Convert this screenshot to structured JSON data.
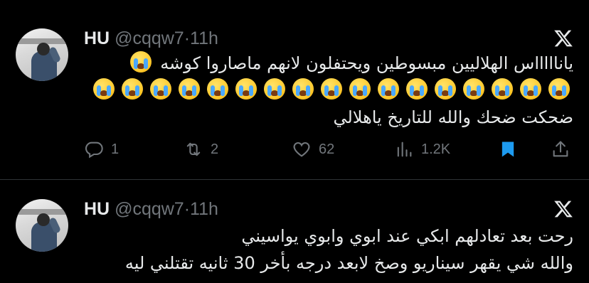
{
  "tweets": [
    {
      "name": "HU",
      "handle": "@cqqw7",
      "separator": "·",
      "time": "11h",
      "lines": [
        "ياناااااس الهلاليين مبسوطين ويحتفلون لانهم ماصاروا كوشه",
        "",
        "ضحكت ضحك والله للتاريخ ياهلالي"
      ],
      "emoji_count_line1": 1,
      "emoji_count_line2": 17,
      "emoji_name": "loudly-crying-face",
      "actions": {
        "replies": "1",
        "reposts": "2",
        "likes": "62",
        "views": "1.2K"
      },
      "bookmark_color": "#1d9bf0"
    },
    {
      "name": "HU",
      "handle": "@cqqw7",
      "separator": "·",
      "time": "11h",
      "lines": [
        "رحت بعد تعادلهم ابكي عند ابوي وابوي يواسيني",
        "والله شي يقهر سيناريو وصخ لابعد درجه بأخر 30 ثانيه تقتلني ليه"
      ]
    }
  ]
}
